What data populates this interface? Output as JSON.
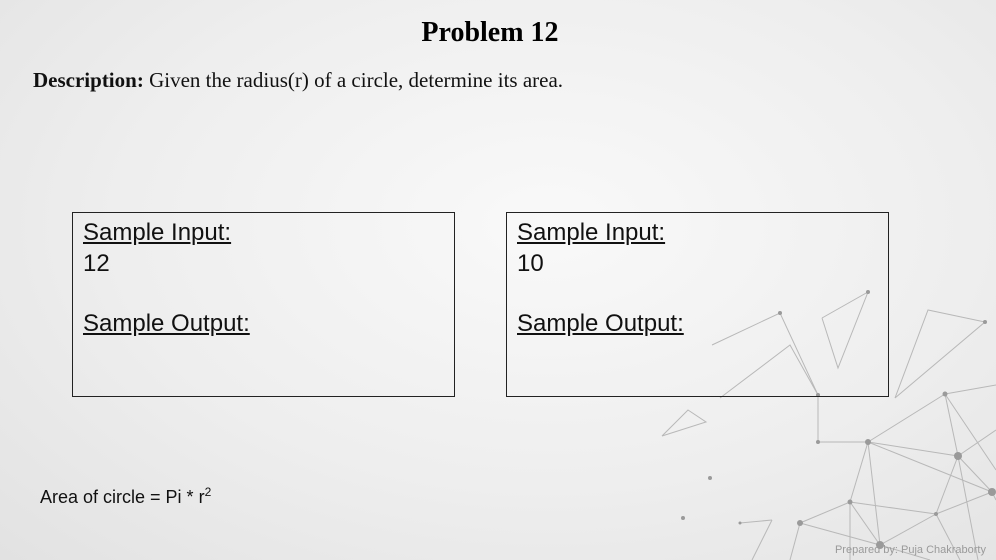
{
  "slide": {
    "title": "Problem 12",
    "description_label": "Description:",
    "description_text": "Given the radius(r) of a circle, determine its area.",
    "samples": [
      {
        "input_label": "Sample Input:",
        "input_value": "12",
        "output_label": "Sample Output:"
      },
      {
        "input_label": "Sample Input:",
        "input_value": "10",
        "output_label": "Sample Output:"
      }
    ],
    "formula_text": "Area of circle = Pi * r",
    "formula_exponent": "2",
    "footer": "Prepared by: Puja Chakraborty"
  }
}
